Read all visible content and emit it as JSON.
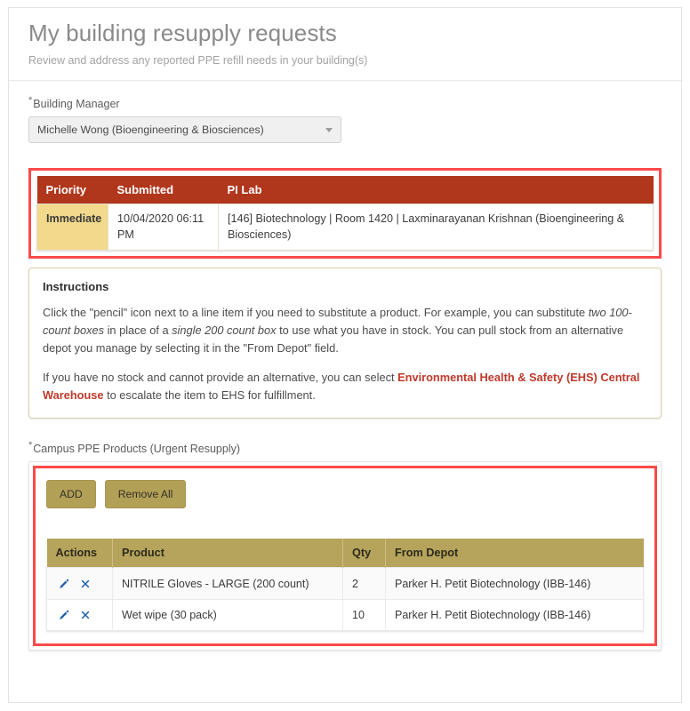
{
  "header": {
    "title": "My building resupply requests",
    "subtitle": "Review and address any reported PPE refill needs in your building(s)"
  },
  "building_manager": {
    "label": "Building Manager",
    "required_marker": "*",
    "value": "Michelle Wong (Bioengineering & Biosciences)",
    "caret_icon": "chevron-down-icon"
  },
  "request_table": {
    "columns": [
      "Priority",
      "Submitted",
      "PI Lab"
    ],
    "rows": [
      {
        "priority": "Immediate",
        "submitted": "10/04/2020 06:11 PM",
        "pi_lab": "[146] Biotechnology | Room 1420 | Laxminarayanan Krishnan (Bioengineering & Biosciences)"
      }
    ]
  },
  "instructions": {
    "heading": "Instructions",
    "para1_a": "Click the \"pencil\" icon next to a line item if you need to substitute a product. For example, you can substitute ",
    "para1_em1": "two 100-count boxes",
    "para1_b": " in place of a ",
    "para1_em2": "single 200 count box",
    "para1_c": " to use what you have in stock. You can pull stock from an alternative depot you manage by selecting it in the \"From Depot\" field.",
    "para2_a": "If you have no stock and cannot provide an alternative, you can select ",
    "para2_link": "Environmental Health & Safety (EHS) Central Warehouse",
    "para2_b": " to escalate the item to EHS for fulfillment."
  },
  "products": {
    "label": "Campus PPE Products (Urgent Resupply)",
    "required_marker": "*",
    "add_label": "ADD",
    "remove_all_label": "Remove All",
    "columns": [
      "Actions",
      "Product",
      "Qty",
      "From Depot"
    ],
    "edit_icon": "pencil-icon",
    "delete_icon": "close-x-icon",
    "rows": [
      {
        "product": "NITRILE Gloves - LARGE (200 count)",
        "qty": "2",
        "depot": "Parker H. Petit Biotechnology (IBB-146)"
      },
      {
        "product": "Wet wipe (30 pack)",
        "qty": "10",
        "depot": "Parker H. Petit Biotechnology (IBB-146)"
      }
    ]
  },
  "colors": {
    "priority_header": "#b0361c",
    "priority_cell": "#f2d98c",
    "table_header": "#b6a45c",
    "button": "#b3a057",
    "highlight_border": "#fa4a4a",
    "link_red": "#c0392b",
    "icon_blue": "#1f5faa"
  }
}
